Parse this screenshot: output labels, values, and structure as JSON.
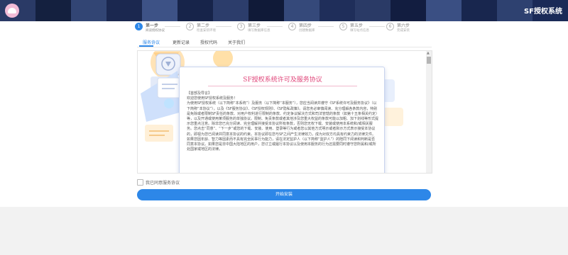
{
  "app": {
    "title": "SF授权系统"
  },
  "steps": [
    {
      "number": "1",
      "title": "第一步",
      "desc": "阅读授权协议"
    },
    {
      "number": "2",
      "title": "第二步",
      "desc": "检查安装环境"
    },
    {
      "number": "3",
      "title": "第三步",
      "desc": "填写数据库信息"
    },
    {
      "number": "4",
      "title": "第四步",
      "desc": "创建数据库"
    },
    {
      "number": "5",
      "title": "第五步",
      "desc": "填写站点信息"
    },
    {
      "number": "6",
      "title": "第六步",
      "desc": "完成安装"
    }
  ],
  "tabs": [
    {
      "label": "服务协议"
    },
    {
      "label": "更新记录"
    },
    {
      "label": "授权代码"
    },
    {
      "label": "关于我们"
    }
  ],
  "agreement": {
    "title": "SF授权系统许可及服务协议",
    "heading": "【首部及导言】",
    "welcome": "欢迎您使用SF授权系统及服务！",
    "paragraph": "为使用SF授权系统（以下简称“本系统”）及服务（以下简称“本服务”），您应当阅读并遵守《SF系统许可及服务协议》（以下简称“本协议”），以及《SF服务协议》、《SF授权规则》、《SF隐私政策》。请您务必审慎阅读、充分理解各条款内容，特别是免除或者限制SF责任的条款、对用户权利进行限制的条款、约定争议解决方式和司法管辖的条款（如第十五条相关约定）等，以及开通或使用某项服务的单独协议。限制、免责条款或者其他涉及您重大权益的条款可能以加粗、加下划线等形式提示您重点注意。除非您已充分阅读、完全理解并接受本协议所有条款，否则您无权下载、安装或使用本系统和/或相关服务。您点击“同意”、“下一步”或您的下载、安装、使用、登录等行为或者您以其他方式明示或者默示方式表示接受本协议的，即视为您已阅读并同意本协议的约束。本协议即在您与SF之间产生法律效力，成为对双方均具有约束力的法律文件。如果您因年龄、智力等因素而不具有完全民事行为能力，请在法定监护人（以下简称“监护人”）的陪同下阅读和判断是否同意本协议。如果您是非中国大陆地区的用户，您订立或履行本协议以及使用本服务的行为还需要同时遵守您所属和/或所处国家或地区的法律。"
  },
  "agree": {
    "label": "我已同意服务协议"
  },
  "install_button": {
    "label": "开始安装"
  },
  "colors": {
    "accent": "#2d87e8",
    "title_pink": "#e0467a",
    "header_bg": "#1e2c52"
  },
  "icons": {
    "logo": "cloud-logo-icon",
    "scroll_up": "scroll-up-arrow-icon"
  }
}
